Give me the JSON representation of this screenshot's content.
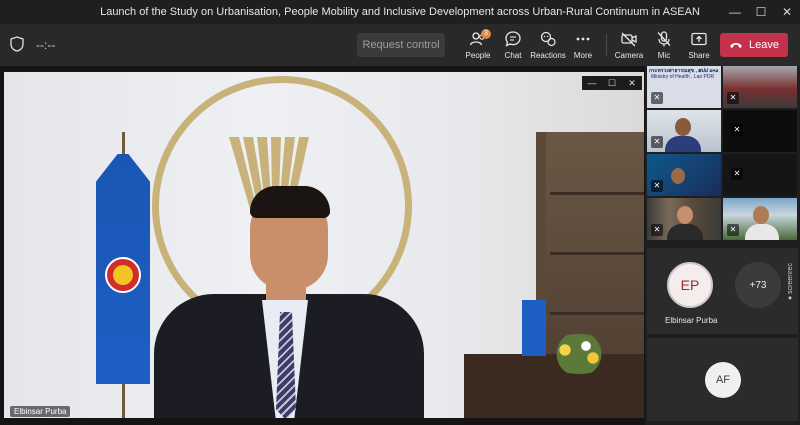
{
  "window": {
    "title": "Launch of the Study on Urbanisation, People Mobility and Inclusive Development across Urban-Rural Continuum in ASEAN",
    "minimize": "—",
    "maximize": "☐",
    "close": "✕"
  },
  "toolbar": {
    "timer": "--:--",
    "request_control": "Request control",
    "people": "People",
    "people_badge": "3",
    "chat": "Chat",
    "reactions": "Reactions",
    "more": "More",
    "camera": "Camera",
    "mic": "Mic",
    "share": "Share",
    "leave": "Leave",
    "leave_color": "#c4314b"
  },
  "stage": {
    "speaker_name": "Elbinsar Purba"
  },
  "participants": {
    "doc_caption_1": "กระทรวงสาธารณสุข , ສປປ ລາວ",
    "doc_caption_2": "Ministry of Health , Lao PDR",
    "ep_initials": "EP",
    "ep_name": "Elbinsar Purba",
    "more_count": "+73",
    "af_initials": "AF"
  },
  "watermark": "● screenrec"
}
